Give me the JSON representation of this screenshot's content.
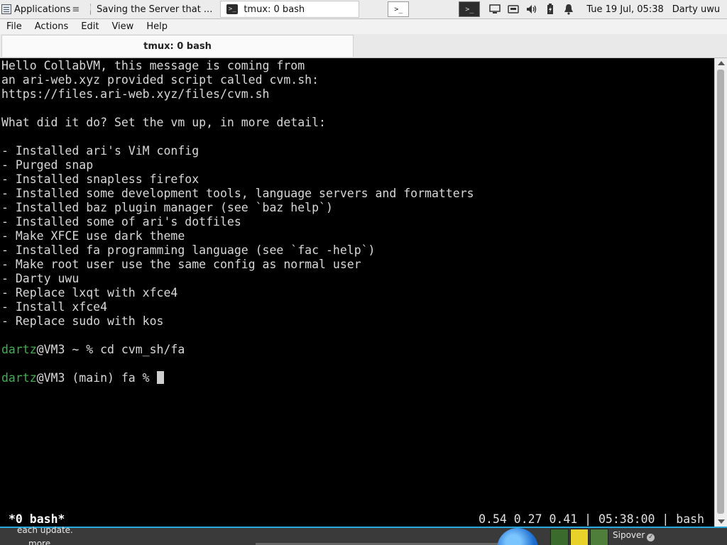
{
  "taskbar": {
    "applications_label": "Applications",
    "applications_suffix": "≡",
    "tasks": [
      {
        "label": "Saving the Server that ...",
        "icon": "firefox-icon"
      },
      {
        "label": "tmux: 0 bash",
        "icon": "terminal-icon"
      }
    ],
    "workspace_glyph": ">_",
    "clock": "Tue 19 Jul, 05:38",
    "user": "Darty uwu"
  },
  "menu": {
    "items": [
      "File",
      "Actions",
      "Edit",
      "View",
      "Help"
    ]
  },
  "tab": {
    "title": "tmux: 0 bash"
  },
  "terminal": {
    "lines": [
      "Hello CollabVM, this message is coming from",
      "an ari-web.xyz provided script called cvm.sh:",
      "https://files.ari-web.xyz/files/cvm.sh",
      "",
      "What did it do? Set the vm up, in more detail:",
      "",
      "- Installed ari's ViM config",
      "- Purged snap",
      "- Installed snapless firefox",
      "- Installed some development tools, language servers and formatters",
      "- Installed baz plugin manager (see `baz help`)",
      "- Installed some of ari's dotfiles",
      "- Make XFCE use dark theme",
      "- Installed fa programming language (see `fac -help`)",
      "- Make root user use the same config as normal user",
      "- Darty uwu",
      "- Replace lxqt with xfce4",
      "- Install xfce4",
      "- Replace sudo with kos",
      ""
    ],
    "prompt1": {
      "user": "dartz",
      "rest": "@VM3 ~ % cd cvm_sh/fa"
    },
    "prompt2": {
      "user": "dartz",
      "rest": "@VM3 (main) fa % "
    },
    "status_left": "*0 bash*",
    "status_right": "0.54 0.27 0.41 | 05:38:00 | bash"
  },
  "desktop_strip": {
    "text1": "each update.",
    "text2": "more",
    "name": "Sipover",
    "verified_glyph": "✓"
  }
}
